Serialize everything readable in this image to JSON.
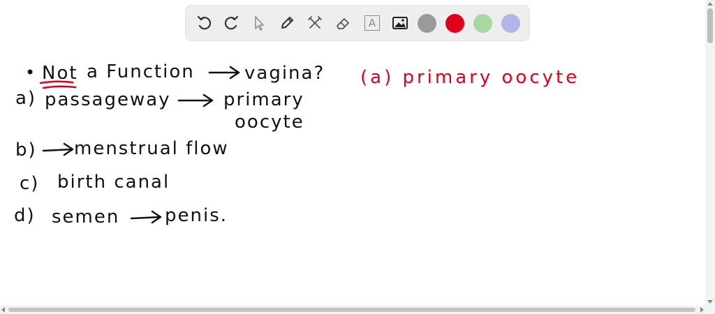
{
  "toolbar": {
    "tools": [
      "undo-icon",
      "redo-icon",
      "select-icon",
      "pen-icon",
      "tools-icon",
      "eraser-icon",
      "text-icon",
      "image-icon"
    ],
    "text_tool_glyph": "A",
    "colors": [
      "#9a9a9a",
      "#e0001b",
      "#a8d8a0",
      "#b4b4ea"
    ]
  },
  "notes": {
    "question_not": "Not",
    "question_rest": "a Function",
    "question_target": "vagina?",
    "a_label": "a)",
    "a_text": "passageway",
    "a_target_line1": "primary",
    "a_target_line2": "oocyte",
    "b_label": "b)",
    "b_text": "menstrual  flow",
    "c_label": "c)",
    "c_text": "birth  canal",
    "d_label": "d)",
    "d_text": "semen",
    "d_target": "penis.",
    "answer": "(a)  primary  oocyte"
  }
}
